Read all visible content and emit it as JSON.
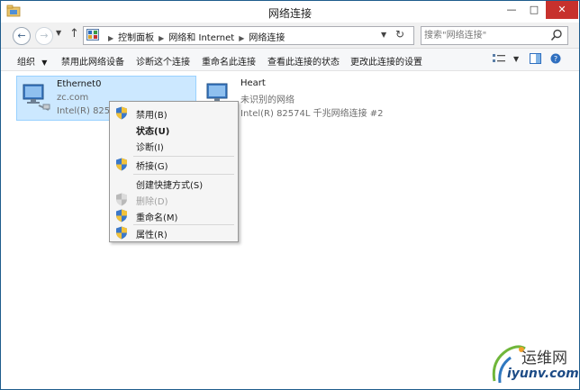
{
  "window": {
    "title": "网络连接",
    "controls": {
      "minimize": "—",
      "maximize": "□",
      "close": "✕"
    }
  },
  "nav": {
    "address_crumbs": [
      "控制面板",
      "网络和 Internet",
      "网络连接"
    ],
    "search_placeholder": "搜索\"网络连接\"",
    "icons": [
      "back-arrow-icon",
      "forward-arrow-icon",
      "up-arrow-icon",
      "refresh-icon",
      "search-icon"
    ]
  },
  "toolbar": {
    "organize": "组织",
    "disable_device": "禁用此网络设备",
    "diagnose": "诊断这个连接",
    "rename": "重命名此连接",
    "view_status": "查看此连接的状态",
    "change_settings": "更改此连接的设置"
  },
  "connections": [
    {
      "name": "Ethernet0",
      "status": "zc.com",
      "adapter": "Intel(R) 82574L 千兆网络连接",
      "selected": true
    },
    {
      "name": "Heart",
      "status": "未识别的网络",
      "adapter": "Intel(R) 82574L 千兆网络连接 #2",
      "selected": false
    }
  ],
  "visible_adapter_text_0": "Intel(R) 8257",
  "context_menu": {
    "items": [
      {
        "label": "禁用(B)",
        "icon": "shield-icon"
      },
      {
        "label": "状态(U)",
        "bold": true
      },
      {
        "label": "诊断(I)"
      },
      {
        "label": "桥接(G)",
        "icon": "shield-icon"
      },
      {
        "label": "创建快捷方式(S)"
      },
      {
        "label": "删除(D)",
        "icon": "shield-icon",
        "disabled": true
      },
      {
        "label": "重命名(M)",
        "icon": "shield-icon"
      },
      {
        "label": "属性(R)",
        "icon": "shield-icon"
      }
    ]
  },
  "watermark": {
    "top": "运维网",
    "bottom": "iyunv.com"
  },
  "colors": {
    "accent": "#1e5c8c",
    "selection": "#cce8ff",
    "close": "#c7312d"
  }
}
